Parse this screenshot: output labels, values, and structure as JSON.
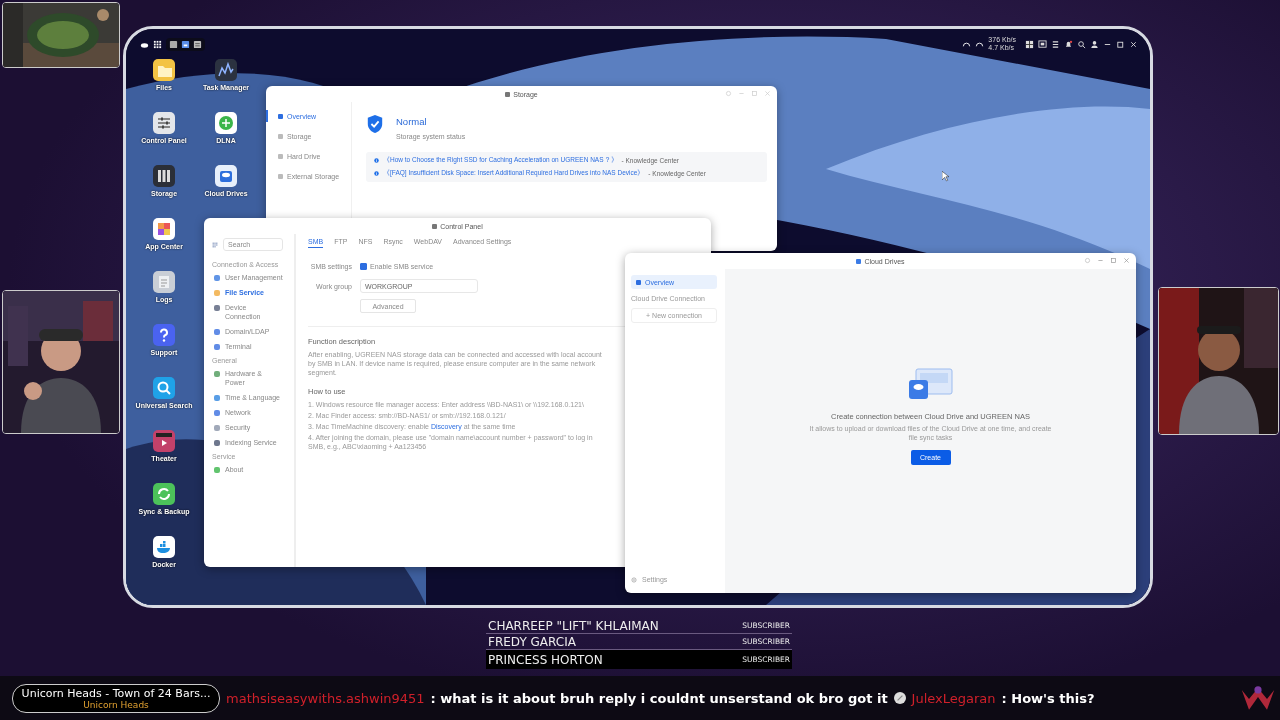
{
  "desktop": {
    "network_speeds": [
      "376 Kb/s",
      "4.7 Kb/s"
    ],
    "apps": [
      "Files",
      "Task Manager",
      "Control Panel",
      "DLNA",
      "Storage",
      "Cloud Drives",
      "App Center",
      "Logs",
      "Support",
      "Universal Search",
      "Theater",
      "Sync & Backup",
      "Docker"
    ],
    "storage_window": {
      "title": "Storage",
      "nav": [
        {
          "label": "Overview",
          "selected": true
        },
        {
          "label": "Storage",
          "selected": false
        },
        {
          "label": "Hard Drive",
          "selected": false
        },
        {
          "label": "External Storage",
          "selected": false
        }
      ],
      "status": "Normal",
      "status_caption": "Storage system status",
      "links": [
        {
          "text": "《How to Choose the Right SSD for Caching Acceleration on UGREEN NAS？》",
          "source": "- Knowledge Center"
        },
        {
          "text": "《[FAQ] Insufficient Disk Space: Insert Additional Required Hard Drives into NAS Device》",
          "source": "- Knowledge Center"
        }
      ]
    },
    "control_panel": {
      "title": "Control Panel",
      "search": {
        "placeholder": "Search"
      },
      "groups": [
        {
          "heading": "Connection & Access",
          "items": [
            {
              "label": "User Management",
              "selected": false
            },
            {
              "label": "File Service",
              "selected": true
            },
            {
              "label": "Device Connection",
              "selected": false
            },
            {
              "label": "Domain/LDAP",
              "selected": false
            },
            {
              "label": "Terminal",
              "selected": false
            }
          ]
        },
        {
          "heading": "General",
          "items": [
            {
              "label": "Hardware & Power",
              "selected": false
            },
            {
              "label": "Time & Language",
              "selected": false
            },
            {
              "label": "Network",
              "selected": false
            },
            {
              "label": "Security",
              "selected": false
            },
            {
              "label": "Indexing Service",
              "selected": false
            }
          ]
        },
        {
          "heading": "Service",
          "items": [
            {
              "label": "About",
              "selected": false
            }
          ]
        }
      ],
      "tabs": [
        {
          "label": "SMB",
          "selected": true
        },
        {
          "label": "FTP",
          "selected": false
        },
        {
          "label": "NFS",
          "selected": false
        },
        {
          "label": "Rsync",
          "selected": false
        },
        {
          "label": "WebDAV",
          "selected": false
        },
        {
          "label": "Advanced Settings",
          "selected": false
        }
      ],
      "smb_label": "SMB settings",
      "enable_smb": {
        "label": "Enable SMB service",
        "checked": true
      },
      "workgroup": {
        "label": "Work group",
        "value": "WORKGROUP"
      },
      "advanced_button": "Advanced",
      "description_title": "Function description",
      "description": "After enabling, UGREEN NAS storage data can be connected and accessed with local account by SMB in LAN. If device name is required, please ensure computer are in the same network segment.",
      "how_to_title": "How to use",
      "how_to": [
        {
          "text": "1. Windows resource file manager access: Enter address \\\\BD-NAS1\\ or \\\\192.168.0.121\\"
        },
        {
          "text": "2. Mac Finder access: smb://BD-NAS1/ or smb://192.168.0.121/"
        },
        {
          "text": "3. Mac TimeMachine discovery: enable",
          "link": "Discovery",
          "after": "at the same time"
        },
        {
          "text": "4. After joining the domain, please use \"domain name\\account number + password\" to log in SMB, e.g., ABC\\xiaoming + Aa123456"
        }
      ]
    },
    "cloud_drives": {
      "title": "Cloud Drives",
      "nav": [
        {
          "label": "Overview",
          "selected": true
        }
      ],
      "section": "Cloud Drive Connection",
      "new_connection": "+ New connection",
      "settings": "Settings",
      "heading": "Create connection between Cloud Drive and UGREEN NAS",
      "subtitle": "It allows to upload or download files of the Cloud Drive at one time, and create file sync tasks",
      "create_button": "Create"
    }
  },
  "overlay": {
    "subscribers": [
      {
        "name": "CHARREEP \"LIFT\" KHLAIMAN",
        "badge": "SUBSCRIBER",
        "highlighted": false
      },
      {
        "name": "FREDY GARCIA",
        "badge": "SUBSCRIBER",
        "highlighted": false
      },
      {
        "name": "PRINCESS HORTON",
        "badge": "SUBSCRIBER",
        "highlighted": true
      }
    ],
    "now_playing": {
      "title": "Unicorn Heads - Town of 24 Bars...",
      "artist": "Unicorn Heads"
    },
    "chat": [
      {
        "user": "mathsiseasywiths.ashwin9451",
        "message": ": what is it about  bruh reply i couldnt unserstand  ok bro got it"
      },
      {
        "user": "JulexLegaran",
        "message": ": How's this?"
      }
    ]
  }
}
